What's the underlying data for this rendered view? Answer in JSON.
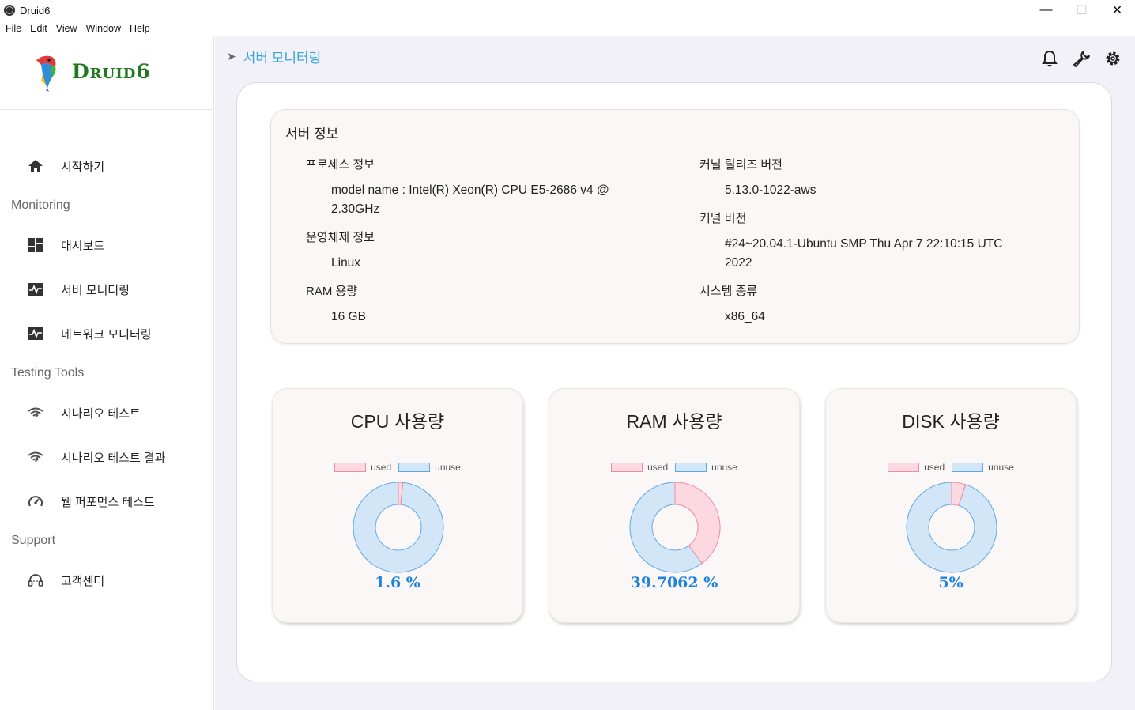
{
  "window": {
    "title": "Druid6",
    "minimize": "—",
    "maximize": "☐",
    "close": "✕"
  },
  "menu": [
    "File",
    "Edit",
    "View",
    "Window",
    "Help"
  ],
  "logo": {
    "text": "Druid6"
  },
  "sidebar": {
    "start": {
      "label": "시작하기",
      "icon": "home-icon"
    },
    "sections": {
      "monitoring": "Monitoring",
      "testing": "Testing Tools",
      "support": "Support"
    },
    "items": {
      "dashboard": {
        "label": "대시보드",
        "icon": "dashboard-icon"
      },
      "server_monitoring": {
        "label": "서버 모니터링",
        "icon": "pulse-icon"
      },
      "network_monitoring": {
        "label": "네트워크 모니터링",
        "icon": "pulse-icon"
      },
      "scenario_test": {
        "label": "시나리오 테스트",
        "icon": "wifi-icon"
      },
      "scenario_result": {
        "label": "시나리오 테스트 결과",
        "icon": "wifi-icon"
      },
      "web_perf": {
        "label": "웹 퍼포먼스 테스트",
        "icon": "speedometer-icon"
      },
      "customer_center": {
        "label": "고객센터",
        "icon": "headset-icon"
      }
    }
  },
  "header": {
    "breadcrumb": "서버 모니터링",
    "icons": [
      "bell-icon",
      "wrench-icon",
      "gear-icon"
    ]
  },
  "server_info": {
    "title": "서버 정보",
    "process_label": "프로세스 정보",
    "process_value_line1": "model name : Intel(R) Xeon(R) CPU E5-2686 v4 @",
    "process_value_line2": "2.30GHz",
    "os_label": "운영체제 정보",
    "os_value": "Linux",
    "ram_label": "RAM 용량",
    "ram_value": "16 GB",
    "kernel_release_label": "커널 릴리즈 버전",
    "kernel_release_value": "5.13.0-1022-aws",
    "kernel_version_label": "커널 버전",
    "kernel_version_line1": "#24~20.04.1-Ubuntu SMP Thu Apr 7 22:10:15 UTC",
    "kernel_version_line2": "2022",
    "system_type_label": "시스템 종류",
    "system_type_value": "x86_64"
  },
  "legend": {
    "used": "used",
    "unuse": "unuse"
  },
  "colors": {
    "used_fill": "#fcd9e0",
    "used_stroke": "#f08aa0",
    "unuse_fill": "#d3e6f8",
    "unuse_stroke": "#5aa9e6",
    "value_text": "#1f84e0",
    "breadcrumb": "#33a3dc"
  },
  "gauges": [
    {
      "title": "CPU 사용량",
      "value_text": "1.6 %",
      "used_percent": 1.6
    },
    {
      "title": "RAM 사용량",
      "value_text": "39.7062 %",
      "used_percent": 39.7062
    },
    {
      "title": "DISK 사용량",
      "value_text": "5%",
      "used_percent": 5
    }
  ]
}
